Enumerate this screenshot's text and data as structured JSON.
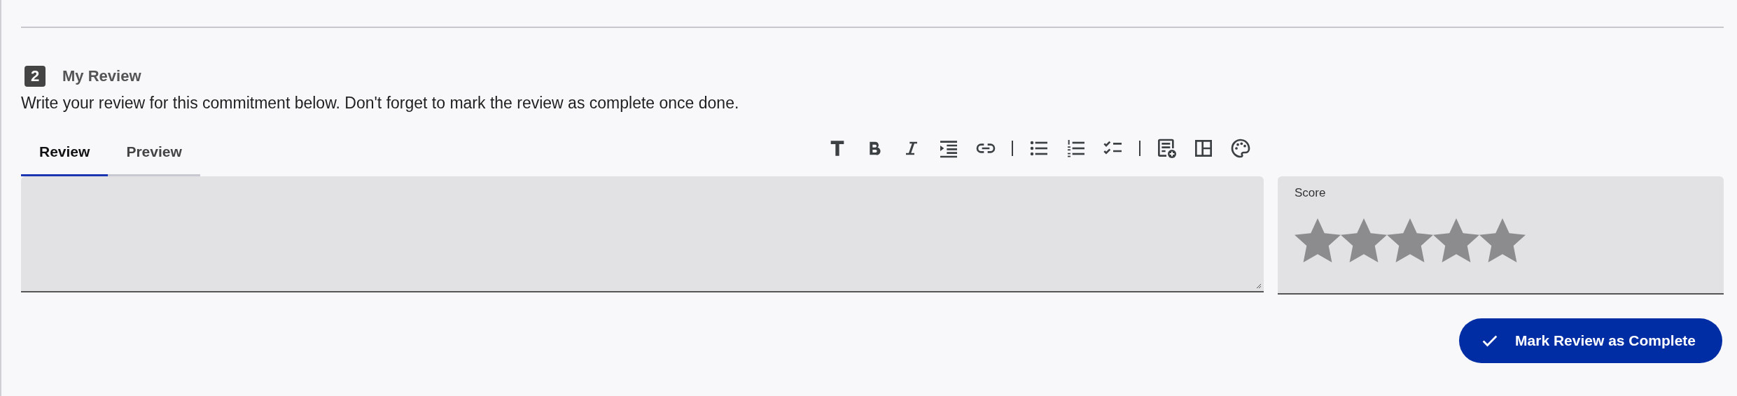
{
  "section": {
    "number": "2",
    "title": "My Review",
    "description": "Write your review for this commitment below. Don't forget to mark the review as complete once done."
  },
  "tabs": [
    {
      "label": "Review",
      "selected": true
    },
    {
      "label": "Preview",
      "selected": false
    }
  ],
  "toolbar": [
    {
      "kind": "heading"
    },
    {
      "kind": "bold"
    },
    {
      "kind": "italic"
    },
    {
      "kind": "indent"
    },
    {
      "kind": "link"
    },
    {
      "kind": "separator"
    },
    {
      "kind": "bullets"
    },
    {
      "kind": "numbers"
    },
    {
      "kind": "tasks"
    },
    {
      "kind": "separator"
    },
    {
      "kind": "template"
    },
    {
      "kind": "layout"
    },
    {
      "kind": "palette"
    }
  ],
  "score": {
    "label": "Score",
    "stars": 0
  },
  "complete_button": {
    "label": "Mark Review as Complete"
  }
}
